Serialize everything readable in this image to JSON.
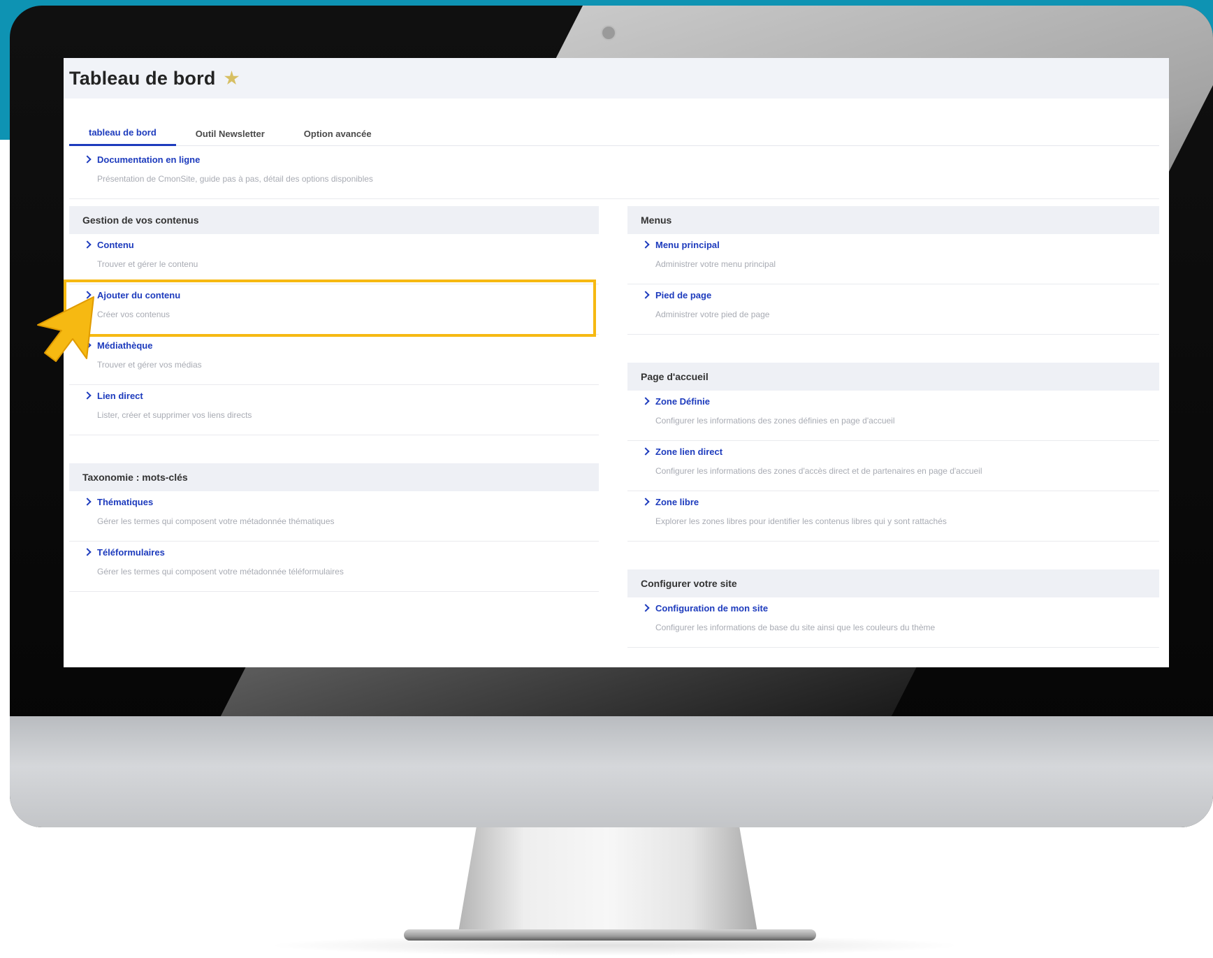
{
  "page": {
    "title": "Tableau de bord",
    "accent_color": "#1d3bbd",
    "highlight_color": "#f6b912"
  },
  "tabs": [
    {
      "label": "tableau de bord",
      "active": true
    },
    {
      "label": "Outil Newsletter",
      "active": false
    },
    {
      "label": "Option avancée",
      "active": false
    }
  ],
  "doc": {
    "title": "Documentation en ligne",
    "desc": "Présentation de CmonSite, guide pas à pas, détail des options disponibles"
  },
  "sections_left": [
    {
      "title": "Gestion de vos contenus",
      "items": [
        {
          "title": "Contenu",
          "desc": "Trouver et gérer le contenu"
        },
        {
          "title": "Ajouter du contenu",
          "desc": "Créer vos contenus"
        },
        {
          "title": "Médiathèque",
          "desc": "Trouver et gérer vos médias"
        },
        {
          "title": "Lien direct",
          "desc": "Lister, créer et supprimer vos liens directs"
        }
      ]
    },
    {
      "title": "Taxonomie : mots-clés",
      "items": [
        {
          "title": "Thématiques",
          "desc": "Gérer les termes qui composent votre métadonnée thématiques"
        },
        {
          "title": "Téléformulaires",
          "desc": "Gérer les termes qui composent votre métadonnée téléformulaires"
        }
      ]
    }
  ],
  "sections_right": [
    {
      "title": "Menus",
      "items": [
        {
          "title": "Menu principal",
          "desc": "Administrer votre menu principal"
        },
        {
          "title": "Pied de page",
          "desc": "Administrer votre pied de page"
        }
      ]
    },
    {
      "title": "Page d'accueil",
      "items": [
        {
          "title": "Zone Définie",
          "desc": "Configurer les informations des zones définies en page d'accueil"
        },
        {
          "title": "Zone lien direct",
          "desc": "Configurer les informations des zones d'accès direct et de partenaires en page d'accueil"
        },
        {
          "title": "Zone libre",
          "desc": "Explorer les zones libres pour identifier les contenus libres qui y sont rattachés"
        }
      ]
    },
    {
      "title": "Configurer votre site",
      "items": [
        {
          "title": "Configuration de mon site",
          "desc": "Configurer les informations de base du site ainsi que les couleurs du thème"
        }
      ]
    }
  ]
}
